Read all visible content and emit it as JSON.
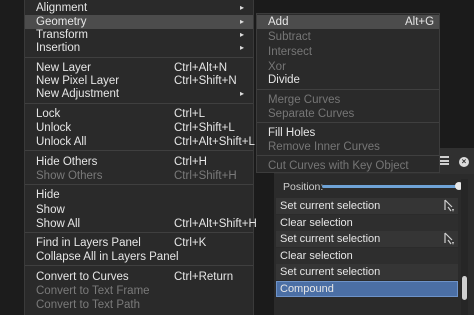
{
  "menu": {
    "items": [
      {
        "label": "Alignment",
        "shortcut": "",
        "submenu": true
      },
      {
        "label": "Geometry",
        "shortcut": "",
        "submenu": true
      },
      {
        "label": "Transform",
        "shortcut": "",
        "submenu": true
      },
      {
        "label": "Insertion",
        "shortcut": "",
        "submenu": true
      },
      {
        "label": "New Layer",
        "shortcut": "Ctrl+Alt+N"
      },
      {
        "label": "New Pixel Layer",
        "shortcut": "Ctrl+Shift+N"
      },
      {
        "label": "New Adjustment",
        "shortcut": "",
        "submenu": true
      },
      {
        "label": "Lock",
        "shortcut": "Ctrl+L"
      },
      {
        "label": "Unlock",
        "shortcut": "Ctrl+Shift+L"
      },
      {
        "label": "Unlock All",
        "shortcut": "Ctrl+Alt+Shift+L"
      },
      {
        "label": "Hide Others",
        "shortcut": "Ctrl+H"
      },
      {
        "label": "Show Others",
        "shortcut": "Ctrl+Shift+H"
      },
      {
        "label": "Hide",
        "shortcut": ""
      },
      {
        "label": "Show",
        "shortcut": ""
      },
      {
        "label": "Show All",
        "shortcut": "Ctrl+Alt+Shift+H"
      },
      {
        "label": "Find in Layers Panel",
        "shortcut": "Ctrl+K"
      },
      {
        "label": "Collapse All in Layers Panel",
        "shortcut": ""
      },
      {
        "label": "Convert to Curves",
        "shortcut": "Ctrl+Return"
      },
      {
        "label": "Convert to Text Frame",
        "shortcut": ""
      },
      {
        "label": "Convert to Text Path",
        "shortcut": ""
      }
    ],
    "arrow_glyph": "▸"
  },
  "submenu": {
    "items": [
      {
        "label": "Add",
        "shortcut": "Alt+G"
      },
      {
        "label": "Subtract",
        "shortcut": ""
      },
      {
        "label": "Intersect",
        "shortcut": ""
      },
      {
        "label": "Xor",
        "shortcut": ""
      },
      {
        "label": "Divide",
        "shortcut": ""
      },
      {
        "label": "Merge Curves",
        "shortcut": ""
      },
      {
        "label": "Separate Curves",
        "shortcut": ""
      },
      {
        "label": "Fill Holes",
        "shortcut": ""
      },
      {
        "label": "Remove Inner Curves",
        "shortcut": ""
      },
      {
        "label": "Cut Curves with Key Object",
        "shortcut": ""
      }
    ]
  },
  "panel": {
    "position_label": "Position:",
    "position_value": 1.0,
    "rows": [
      "Set current selection",
      "Clear selection",
      "Set current selection",
      "Clear selection",
      "Set current selection",
      "Compound"
    ],
    "close_glyph": "×"
  },
  "colors": {
    "menu_bg": "#2a2a2a",
    "highlight": "#4c4c4c",
    "disabled_text": "#7a7a7a",
    "accent": "#4b6fa5",
    "slider": "#6fa3d6"
  }
}
